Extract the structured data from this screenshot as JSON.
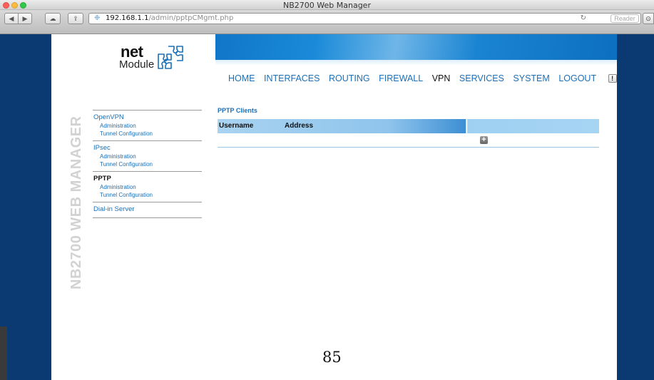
{
  "window": {
    "title": "NB2700 Web Manager"
  },
  "browser": {
    "url_host": "192.168.1.1",
    "url_path": "/admin/pptpCMgmt.php",
    "reader_label": "Reader",
    "reload_icon": "reload-icon",
    "back_icon": "back-arrow-icon",
    "forward_icon": "forward-arrow-icon",
    "cloud_icon": "icloud-tabs-icon",
    "share_icon": "share-icon"
  },
  "brand": {
    "logo_top": "net",
    "logo_bottom": "Module",
    "vertical_title": "NB2700 WEB MANAGER"
  },
  "nav": {
    "items": [
      {
        "label": "HOME"
      },
      {
        "label": "INTERFACES"
      },
      {
        "label": "ROUTING"
      },
      {
        "label": "FIREWALL"
      },
      {
        "label": "VPN",
        "active": true
      },
      {
        "label": "SERVICES"
      },
      {
        "label": "SYSTEM"
      },
      {
        "label": "LOGOUT"
      }
    ],
    "alert_glyph": "!"
  },
  "sidebar": {
    "groups": [
      {
        "title": "OpenVPN",
        "subs": [
          "Administration",
          "Tunnel Configuration"
        ]
      },
      {
        "title": "IPsec",
        "subs": [
          "Administration",
          "Tunnel Configuration"
        ]
      },
      {
        "title": "PPTP",
        "subs": [
          "Administration",
          "Tunnel Configuration"
        ],
        "active": true
      },
      {
        "title": "Dial-in Server",
        "subs": []
      }
    ]
  },
  "main": {
    "section_title": "PPTP Clients",
    "columns": [
      "Username",
      "Address"
    ],
    "add_glyph": "+"
  },
  "footer": {
    "page_number": "85"
  },
  "colors": {
    "accent": "#1a6fb8",
    "page_bg": "#0b3a73",
    "banner": "#1a84d2"
  }
}
